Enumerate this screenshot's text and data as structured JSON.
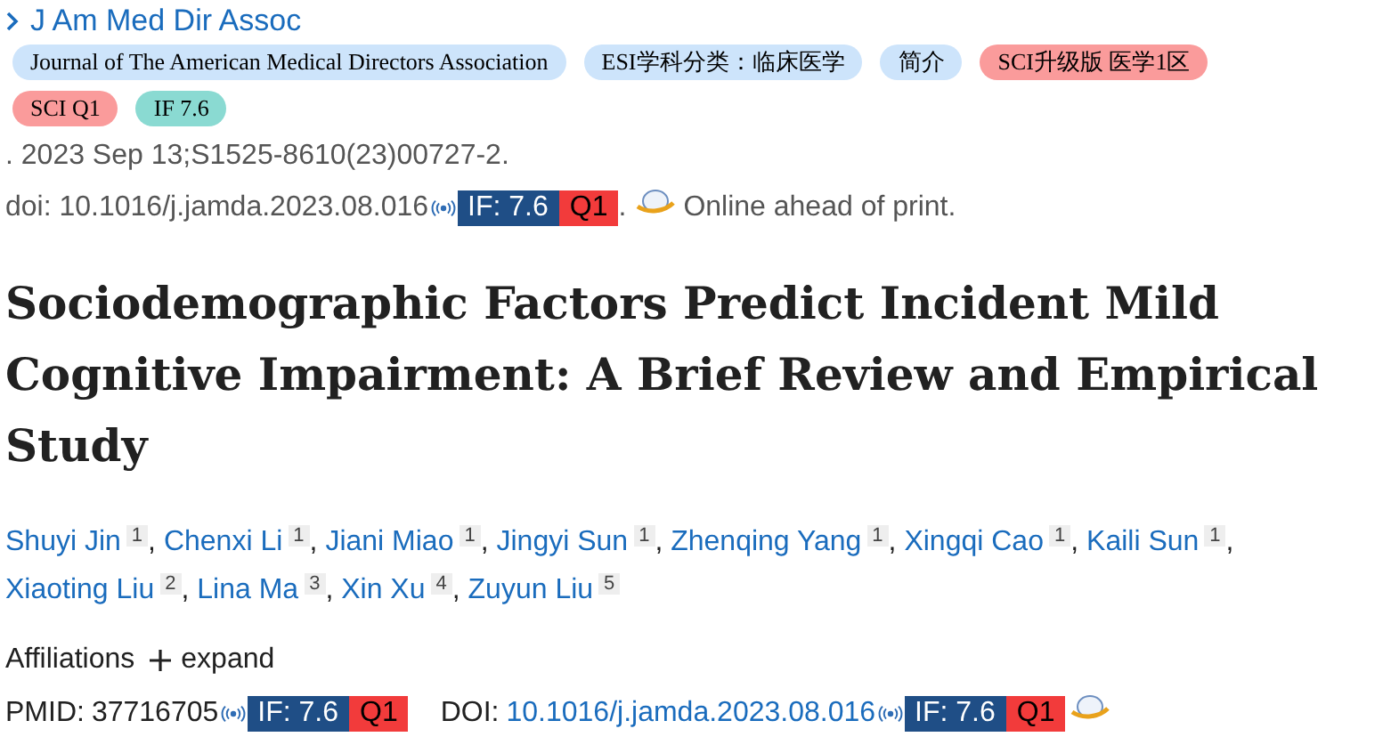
{
  "journal_link": "J Am Med Dir Assoc",
  "tags": [
    {
      "label": "Journal of The American Medical Directors Association",
      "color": "#cde4fb"
    },
    {
      "label": "ESI学科分类：临床医学",
      "color": "#cde4fb"
    },
    {
      "label": "简介",
      "color": "#cde4fb"
    },
    {
      "label": "SCI升级版 医学1区",
      "color": "#fa9b9b"
    },
    {
      "label": "SCI Q1",
      "color": "#fa9b9b"
    },
    {
      "label": "IF 7.6",
      "color": "#8adad2"
    }
  ],
  "citation": ". 2023 Sep 13;S1525-8610(23)00727-2.",
  "doi_line": {
    "text": "doi: 10.1016/j.jamda.2023.08.016",
    "if": "IF: 7.6",
    "quartile": "Q1",
    "dot": ".",
    "status": "Online ahead of print."
  },
  "title": "Sociodemographic Factors Predict Incident Mild Cognitive Impairment: A Brief Review and Empirical Study",
  "authors": [
    {
      "name": "Shuyi Jin",
      "aff": "1",
      "sep": ","
    },
    {
      "name": "Chenxi Li",
      "aff": "1",
      "sep": ","
    },
    {
      "name": "Jiani Miao",
      "aff": "1",
      "sep": ","
    },
    {
      "name": "Jingyi Sun",
      "aff": "1",
      "sep": ","
    },
    {
      "name": "Zhenqing Yang",
      "aff": "1",
      "sep": ","
    },
    {
      "name": "Xingqi Cao",
      "aff": "1",
      "sep": ","
    },
    {
      "name": "Kaili Sun",
      "aff": "1",
      "sep": ","
    },
    {
      "name": "Xiaoting Liu",
      "aff": "2",
      "sep": ","
    },
    {
      "name": "Lina Ma",
      "aff": "3",
      "sep": ","
    },
    {
      "name": "Xin Xu",
      "aff": "4",
      "sep": ","
    },
    {
      "name": "Zuyun Liu",
      "aff": "5"
    }
  ],
  "affiliations": {
    "label": "Affiliations",
    "toggle": "expand"
  },
  "ids": {
    "pmid_label": "PMID:",
    "pmid": "37716705",
    "pmid_if": "IF: 7.6",
    "pmid_q": "Q1",
    "doi_label": "DOI:",
    "doi": "10.1016/j.jamda.2023.08.016",
    "doi_if": "IF: 7.6",
    "doi_q": "Q1"
  }
}
